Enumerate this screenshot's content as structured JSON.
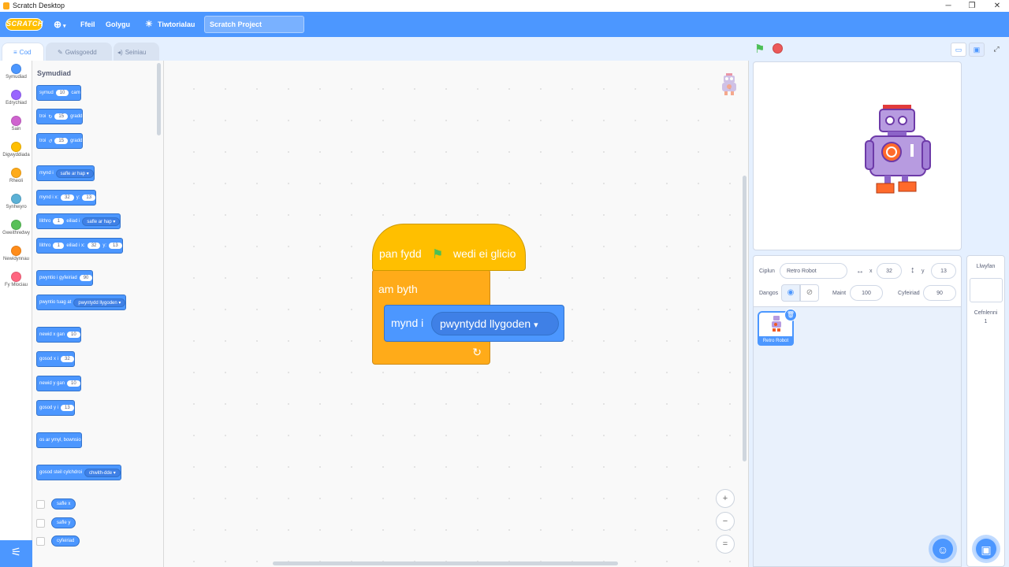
{
  "window": {
    "title": "Scratch Desktop",
    "controls": {
      "minimize": "─",
      "maximize": "❐",
      "close": "✕"
    }
  },
  "menubar": {
    "logo": "SCRATCH",
    "language_icon": "globe-icon",
    "file": "Ffeil",
    "edit": "Golygu",
    "tutorials": "Tiwtorialau",
    "project_title": "Scratch Project"
  },
  "tabs": [
    {
      "label": "Cod",
      "icon": "code-icon"
    },
    {
      "label": "Gwisgoedd",
      "icon": "brush-icon"
    },
    {
      "label": "Seiniau",
      "icon": "speaker-icon"
    }
  ],
  "categories": [
    {
      "label": "Symudiad",
      "color": "#4c97ff"
    },
    {
      "label": "Edrychiad",
      "color": "#9966ff"
    },
    {
      "label": "Sain",
      "color": "#cf63cf"
    },
    {
      "label": "Digwyddiada",
      "color": "#ffbf00"
    },
    {
      "label": "Rheoli",
      "color": "#ffab19"
    },
    {
      "label": "Synhwyro",
      "color": "#5cb1d6"
    },
    {
      "label": "Gweithredwy",
      "color": "#59c059"
    },
    {
      "label": "Newidynnau",
      "color": "#ff8c1a"
    },
    {
      "label": "Fy Mlociau",
      "color": "#ff6680"
    }
  ],
  "palette": {
    "heading": "Symudiad",
    "blocks": {
      "move": {
        "a": "symud",
        "v": "10",
        "b": "cam"
      },
      "turn_right": {
        "a": "troi",
        "v": "15",
        "b": "gradd"
      },
      "turn_left": {
        "a": "troi",
        "v": "15",
        "b": "gradd"
      },
      "goto": {
        "a": "mynd i",
        "d": "safle ar hap"
      },
      "goto_xy": {
        "a": "mynd i x:",
        "x": "32",
        "b": "y:",
        "y": "13"
      },
      "glide": {
        "a": "llithro",
        "v": "1",
        "b": "eiliad i",
        "d": "safle ar hap"
      },
      "glide_xy": {
        "a": "llithro",
        "v": "1",
        "b": "eiliad i x:",
        "x": "32",
        "c": "y:",
        "y": "13"
      },
      "point_dir": {
        "a": "pwyntio i gyfeiriad",
        "v": "90"
      },
      "point_towards": {
        "a": "pwyntio tuag at",
        "d": "pwyntydd llygoden"
      },
      "change_x": {
        "a": "newid x gan",
        "v": "10"
      },
      "set_x": {
        "a": "gosod x i",
        "v": "32"
      },
      "change_y": {
        "a": "newid y gan",
        "v": "10"
      },
      "set_y": {
        "a": "gosod y i",
        "v": "13"
      },
      "bounce": {
        "a": "os ar ymyl, bownsio"
      },
      "rotation_style": {
        "a": "gosod steil cylchdroi",
        "d": "chwith-dde"
      }
    },
    "reporters": [
      "safle x",
      "safle y",
      "cyfeiriad"
    ]
  },
  "script": {
    "hat_a": "pan fydd",
    "hat_b": "wedi ei glicio",
    "forever": "am byth",
    "motion": "mynd i",
    "motion_dropdown": "pwyntydd llygoden"
  },
  "zoom": {
    "in": "+",
    "out": "−",
    "reset": "="
  },
  "stage_controls": {
    "green_flag": "green-flag-icon",
    "stop": "stop-icon"
  },
  "sprite_info": {
    "sprite_label": "Ciplun",
    "sprite_name": "Retro Robot",
    "x_label": "x",
    "x": "32",
    "y_label": "y",
    "y": "13",
    "show_label": "Dangos",
    "size_label": "Maint",
    "size": "100",
    "direction_label": "Cyfeiriad",
    "direction": "90"
  },
  "sprites": [
    {
      "name": "Retro Robot"
    }
  ],
  "stage_panel": {
    "title": "Llwyfan",
    "backdrops_label": "Cefnlenni",
    "backdrops_count": "1"
  },
  "colors": {
    "motion": "#4c97ff",
    "events": "#ffbf00",
    "control": "#ffab19",
    "accent": "#4c97ff"
  }
}
